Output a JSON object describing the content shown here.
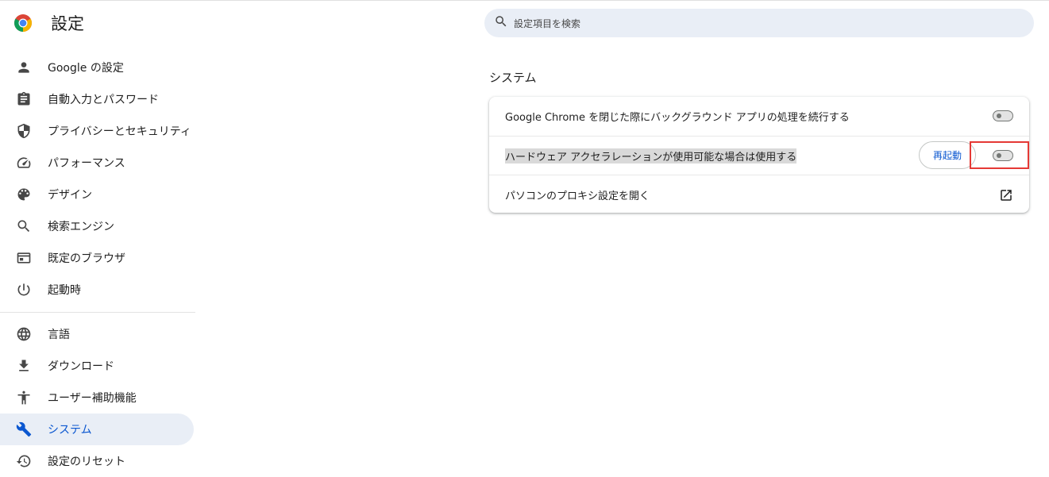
{
  "header": {
    "title": "設定",
    "logo_icon": "chrome-logo-icon",
    "search_placeholder": "設定項目を検索"
  },
  "sidebar": {
    "items": [
      {
        "label": "Google の設定",
        "icon": "person-icon"
      },
      {
        "label": "自動入力とパスワード",
        "icon": "clipboard-icon"
      },
      {
        "label": "プライバシーとセキュリティ",
        "icon": "shield-icon"
      },
      {
        "label": "パフォーマンス",
        "icon": "speedometer-icon"
      },
      {
        "label": "デザイン",
        "icon": "palette-icon"
      },
      {
        "label": "検索エンジン",
        "icon": "search-icon"
      },
      {
        "label": "既定のブラウザ",
        "icon": "browser-window-icon"
      },
      {
        "label": "起動時",
        "icon": "power-icon"
      },
      {
        "label": "言語",
        "icon": "globe-icon"
      },
      {
        "label": "ダウンロード",
        "icon": "download-icon"
      },
      {
        "label": "ユーザー補助機能",
        "icon": "accessibility-icon"
      },
      {
        "label": "システム",
        "icon": "wrench-icon",
        "active": true
      },
      {
        "label": "設定のリセット",
        "icon": "reset-history-icon"
      }
    ]
  },
  "main": {
    "section_title": "システム",
    "rows": [
      {
        "label": "Google Chrome を閉じた際にバックグラウンド アプリの処理を続行する",
        "toggle": "off"
      },
      {
        "label": "ハードウェア アクセラレーションが使用可能な場合は使用する",
        "toggle": "off",
        "button": "再起動"
      },
      {
        "label": "パソコンのプロキシ設定を開く",
        "icon": "open-in-new-icon"
      }
    ]
  },
  "colors": {
    "accent": "#0b57d0",
    "active_bg": "#e9eef6",
    "highlight_box": "#e53935"
  }
}
